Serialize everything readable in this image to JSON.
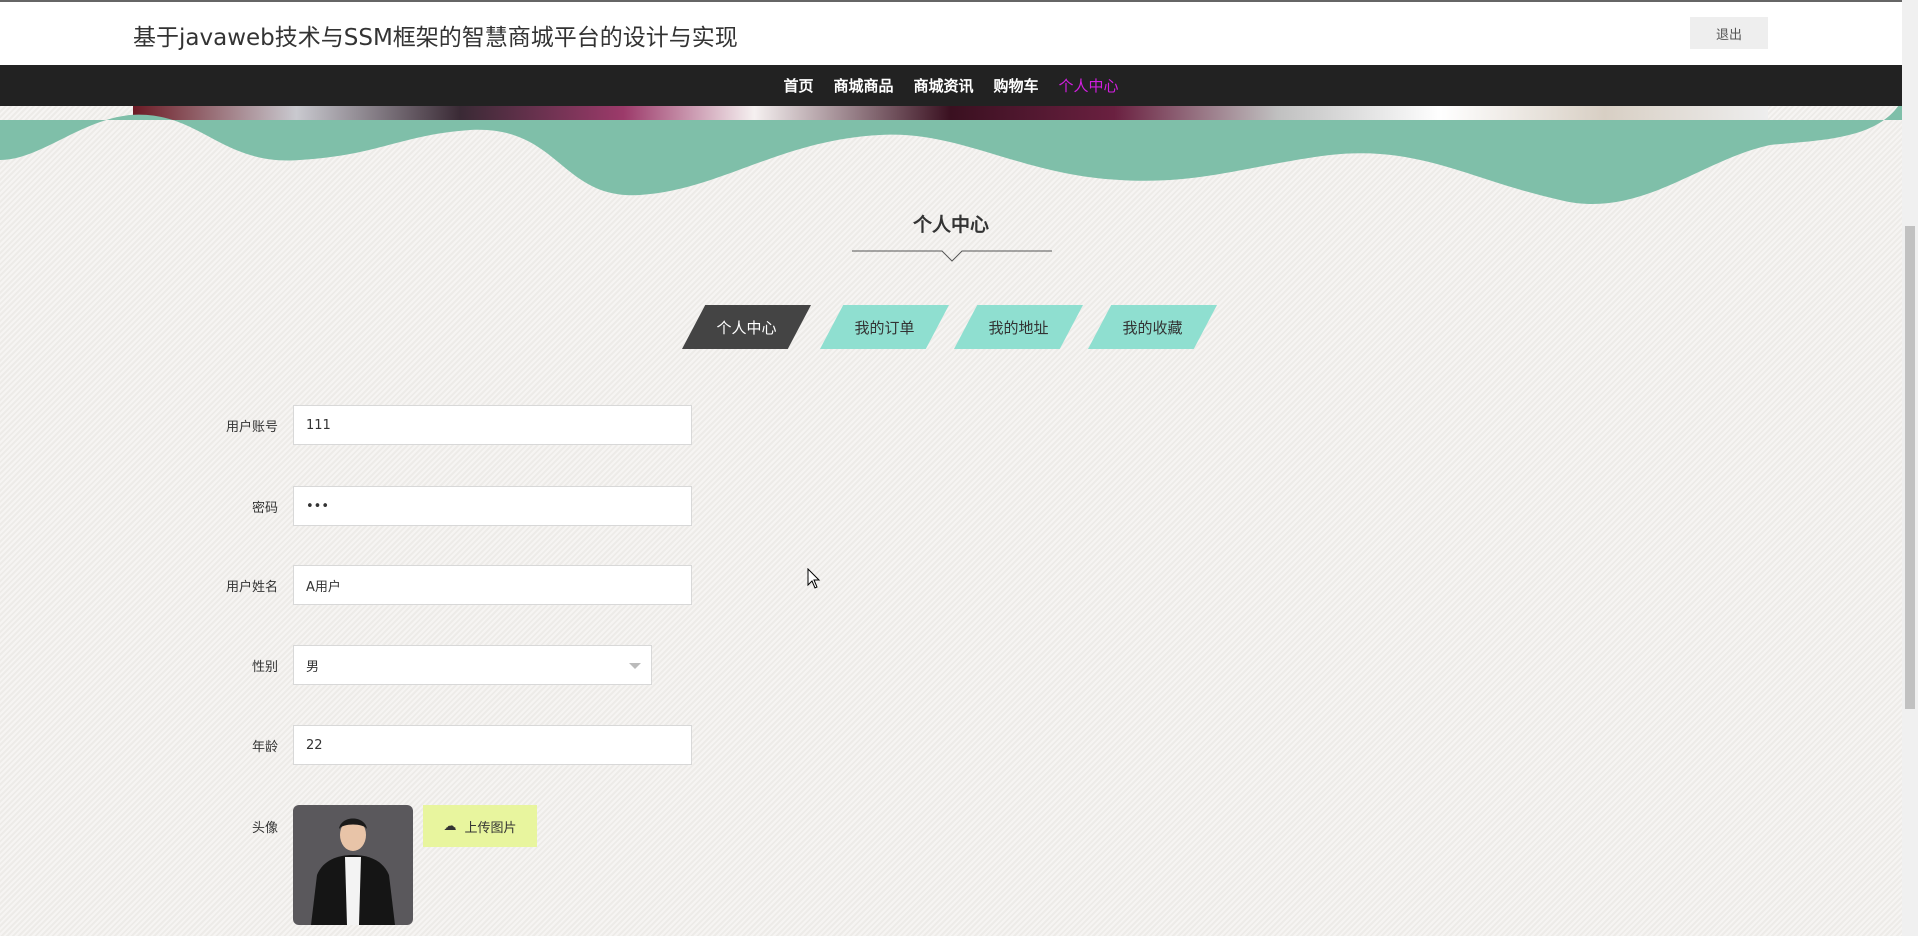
{
  "header": {
    "title": "基于javaweb技术与SSM框架的智慧商城平台的设计与实现",
    "logout": "退出"
  },
  "nav": {
    "items": [
      "首页",
      "商城商品",
      "商城资讯",
      "购物车",
      "个人中心"
    ],
    "active_index": 4,
    "active_color": "#d21ee0"
  },
  "section": {
    "heading": "个人中心"
  },
  "tabs": [
    "个人中心",
    "我的订单",
    "我的地址",
    "我的收藏"
  ],
  "form": {
    "account": {
      "label": "用户账号",
      "value": "111"
    },
    "password": {
      "label": "密码",
      "value": "•••"
    },
    "name": {
      "label": "用户姓名",
      "value": "A用户"
    },
    "gender": {
      "label": "性别",
      "value": "男"
    },
    "age": {
      "label": "年龄",
      "value": "22"
    },
    "avatar": {
      "label": "头像",
      "upload": "上传图片"
    }
  }
}
